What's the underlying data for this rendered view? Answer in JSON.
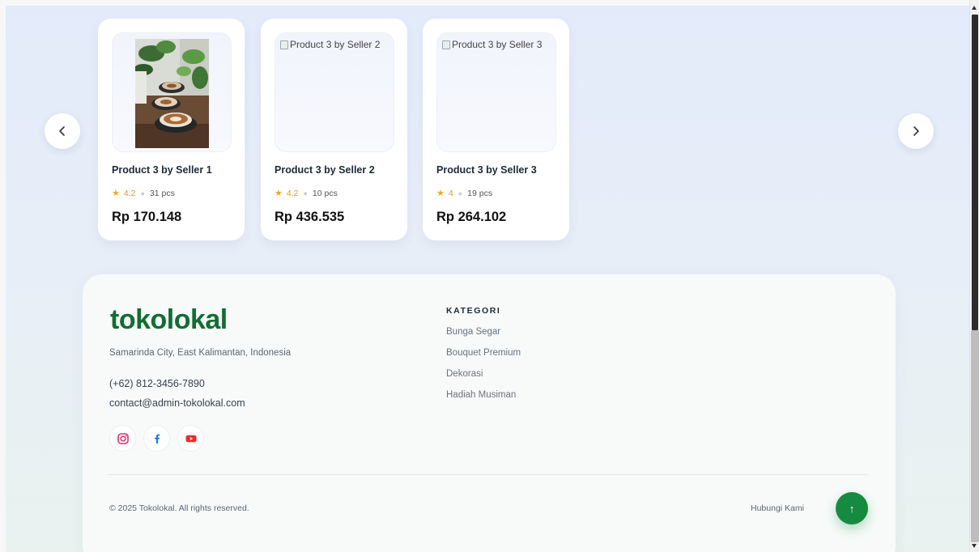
{
  "carousel": {
    "prev_label": "‹",
    "next_label": "›",
    "products": [
      {
        "image_alt": "",
        "image": "photo-coffee-plants",
        "name": "Product 3 by Seller 1",
        "rating": "4.2",
        "stock": "31 pcs",
        "price": "Rp 170.148"
      },
      {
        "image_alt": "Product 3 by Seller 2",
        "image": "broken-image",
        "name": "Product 3 by Seller 2",
        "rating": "4.2",
        "stock": "10 pcs",
        "price": "Rp 436.535"
      },
      {
        "image_alt": "Product 3 by Seller 3",
        "image": "broken-image",
        "name": "Product 3 by Seller 3",
        "rating": "4",
        "stock": "19 pcs",
        "price": "Rp 264.102"
      }
    ]
  },
  "footer": {
    "brand": "tokolokal",
    "address": "Samarinda City, East Kalimantan, Indonesia",
    "phone": "(+62) 812-3456-7890",
    "email": "contact@admin-tokolokal.com",
    "socials": [
      "instagram-icon",
      "facebook-icon",
      "youtube-icon"
    ],
    "category_heading": "KATEGORI",
    "categories": [
      "Bunga Segar",
      "Bouquet Premium",
      "Dekorasi",
      "Hadiah Musiman"
    ],
    "copyright": "© 2025 Tokolokal. All rights reserved.",
    "contact_link": "Hubungi Kami",
    "back_to_top": "↑"
  },
  "colors": {
    "brand_green": "#136c34",
    "button_green": "#178a42",
    "star": "#f5a623"
  }
}
